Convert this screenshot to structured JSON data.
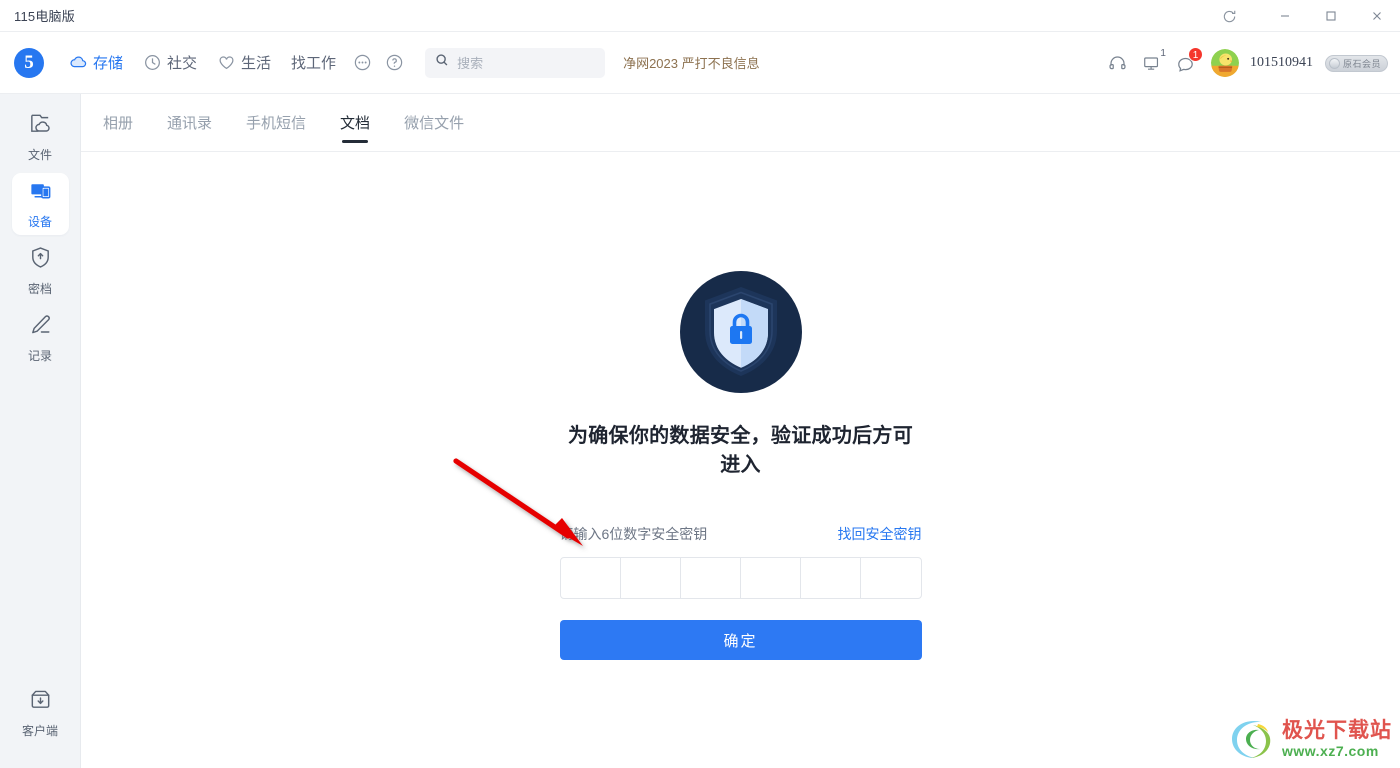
{
  "window": {
    "title": "115电脑版",
    "controls": {
      "refresh": "refresh-icon",
      "minimize": "minimize-icon",
      "maximize": "maximize-icon",
      "close": "close-icon"
    }
  },
  "header": {
    "logo_text": "5",
    "nav": [
      {
        "label": "存储",
        "icon": "cloud-icon",
        "active": true
      },
      {
        "label": "社交",
        "icon": "clock-icon",
        "active": false
      },
      {
        "label": "生活",
        "icon": "heart-icon",
        "active": false
      },
      {
        "label": "找工作",
        "icon": "",
        "active": false
      }
    ],
    "more_icon": "more-ellipsis-icon",
    "help_icon": "help-question-icon",
    "search": {
      "placeholder": "搜索",
      "value": "",
      "icon": "search-icon"
    },
    "slogan": "净网2023 严打不良信息",
    "right": {
      "headset_icon": "headset-icon",
      "monitor_icon": "monitor-icon",
      "monitor_badge": "1",
      "message_icon": "message-icon",
      "message_badge": "1",
      "avatar": "user-avatar",
      "username": "101510941",
      "vip_label": "原石会员"
    }
  },
  "sidebar": {
    "items": [
      {
        "label": "文件",
        "icon": "file-cloud-icon",
        "active": false
      },
      {
        "label": "设备",
        "icon": "device-screens-icon",
        "active": true
      },
      {
        "label": "密档",
        "icon": "shield-archive-icon",
        "active": false
      },
      {
        "label": "记录",
        "icon": "pencil-record-icon",
        "active": false
      }
    ],
    "bottom": {
      "label": "客户端",
      "icon": "download-box-icon"
    }
  },
  "tabs": [
    {
      "label": "相册",
      "active": false
    },
    {
      "label": "通讯录",
      "active": false
    },
    {
      "label": "手机短信",
      "active": false
    },
    {
      "label": "文档",
      "active": true
    },
    {
      "label": "微信文件",
      "active": false
    }
  ],
  "main": {
    "shield_icon": "shield-lock-icon",
    "heading": "为确保你的数据安全，验证成功后方可进入",
    "input_label": "请输入6位数字安全密钥",
    "recover_link": "找回安全密钥",
    "pin": [
      "",
      "",
      "",
      "",
      "",
      ""
    ],
    "confirm_label": "确定"
  },
  "watermark": {
    "name": "极光下载站",
    "url": "www.xz7.com"
  },
  "colors": {
    "accent": "#2777f0",
    "button": "#2d79f3",
    "badge_red": "#f5362c",
    "slogan": "#8d7250",
    "sidebar_bg": "#f2f4f7"
  }
}
